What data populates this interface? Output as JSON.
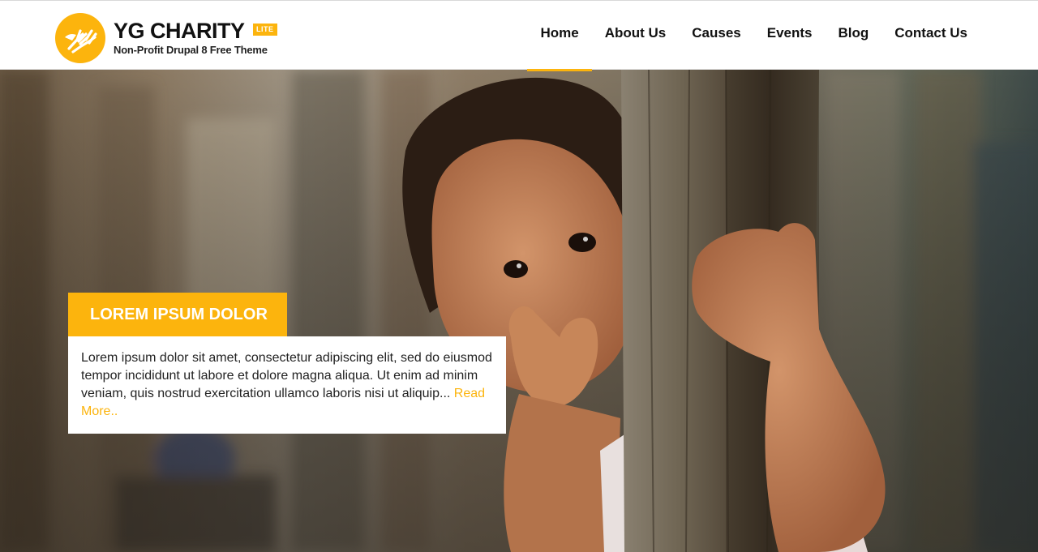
{
  "site": {
    "title": "YG CHARITY",
    "badge": "LITE",
    "tagline": "Non-Profit Drupal 8 Free Theme",
    "accent_color": "#fcb40d",
    "logo_icon": "hands-icon"
  },
  "nav": {
    "items": [
      {
        "label": "Home",
        "active": true
      },
      {
        "label": "About Us"
      },
      {
        "label": "Causes"
      },
      {
        "label": "Events"
      },
      {
        "label": "Blog"
      },
      {
        "label": "Contact Us"
      }
    ]
  },
  "slide": {
    "title": "LOREM IPSUM DOLOR",
    "text": "Lorem ipsum dolor sit amet, consectetur adipiscing elit, sed do eiusmod tempor incididunt ut labore et dolore magna aliqua. Ut enim ad minim veniam, quis nostrud exercitation ullamco laboris nisi ut aliquip...",
    "read_more": "Read More.."
  }
}
